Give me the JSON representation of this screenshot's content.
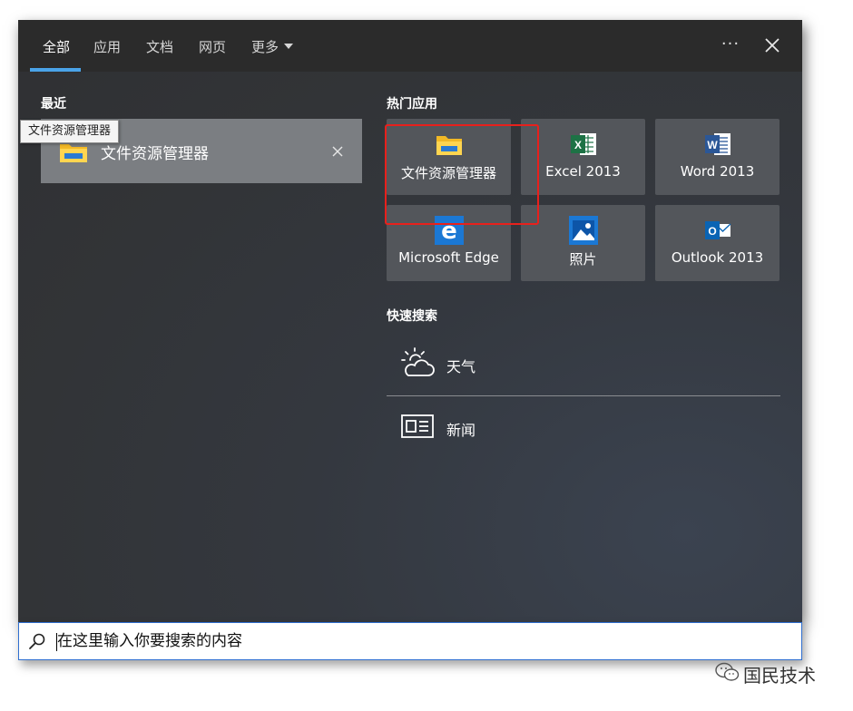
{
  "tabs": [
    {
      "label": "全部",
      "active": true
    },
    {
      "label": "应用",
      "active": false
    },
    {
      "label": "文档",
      "active": false
    },
    {
      "label": "网页",
      "active": false
    },
    {
      "label": "更多",
      "active": false
    }
  ],
  "header": {
    "more_icon": "ellipsis-icon",
    "close_icon": "close-icon"
  },
  "recent": {
    "title": "最近",
    "item": {
      "label": "文件资源管理器",
      "icon": "folder-icon",
      "tooltip": "文件资源管理器"
    }
  },
  "top_apps": {
    "title": "热门应用",
    "items": [
      {
        "label": "文件资源管理器",
        "icon": "folder-icon"
      },
      {
        "label": "Excel 2013",
        "icon": "excel-icon"
      },
      {
        "label": "Word 2013",
        "icon": "word-icon"
      },
      {
        "label": "Microsoft Edge",
        "icon": "edge-icon"
      },
      {
        "label": "照片",
        "icon": "photos-icon"
      },
      {
        "label": "Outlook 2013",
        "icon": "outlook-icon"
      }
    ]
  },
  "quick_search": {
    "title": "快速搜索",
    "items": [
      {
        "label": "天气",
        "icon": "weather-icon"
      },
      {
        "label": "新闻",
        "icon": "news-icon"
      }
    ]
  },
  "search": {
    "placeholder": "在这里输入你要搜索的内容",
    "value": ""
  },
  "watermark": {
    "text": "国民技术"
  },
  "colors": {
    "accent": "#4aa3e8",
    "highlight_box": "#e8201c",
    "tile": "#53565b",
    "recent_item": "#7b7e82"
  }
}
